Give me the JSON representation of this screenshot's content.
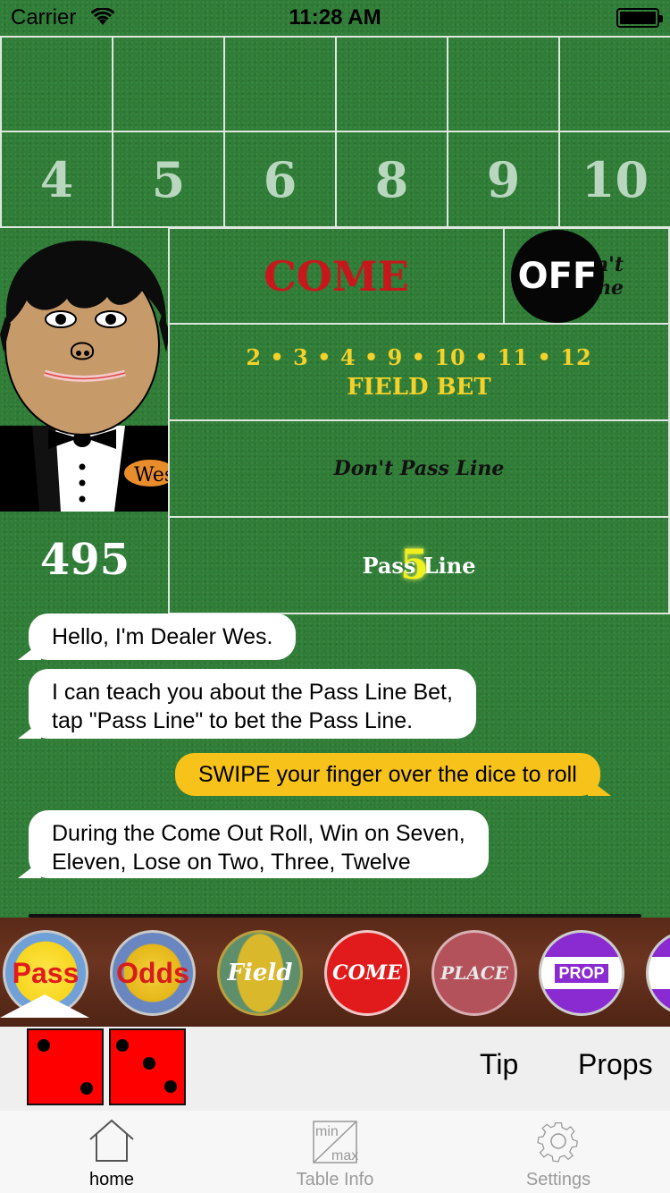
{
  "status_bar": {
    "carrier": "Carrier",
    "time": "11:28 AM"
  },
  "table": {
    "place_numbers": [
      "4",
      "5",
      "6",
      "8",
      "9",
      "10"
    ],
    "come_label": "COME",
    "dont_come_label_line1": "Don't",
    "dont_come_label_line2": "Come",
    "puck_label": "OFF",
    "field_numbers": "2 • 3 • 4 • 9 • 10 • 11 • 12",
    "field_label": "FIELD BET",
    "dont_pass_label": "Don't Pass Line",
    "pass_label": "Pass Line",
    "point_marker": "5"
  },
  "dealer": {
    "name_tag": "Wes",
    "bankroll": "495"
  },
  "chat": {
    "messages": [
      {
        "text": "Hello, I'm Dealer Wes."
      },
      {
        "text_line1": "I can teach you about the Pass Line Bet,",
        "text_line2": "tap \"Pass Line\" to bet the Pass Line."
      },
      {
        "text": "SWIPE your finger over the dice to roll"
      },
      {
        "text_line1": "During the Come Out Roll, Win on Seven,",
        "text_line2": "Eleven, Lose on Two, Three, Twelve"
      }
    ]
  },
  "chip_rail": {
    "chips": [
      {
        "label": "Pass",
        "color": "#f7d51f"
      },
      {
        "label": "Odds",
        "color": "#e6b619"
      },
      {
        "label": "Field",
        "color": "#6b9a6b"
      },
      {
        "label": "COME",
        "color": "#e11b1b"
      },
      {
        "label": "PLACE",
        "color": "#b3525b"
      },
      {
        "label": "PROP",
        "color": "#8a2bd2"
      },
      {
        "label": "P",
        "color": "#8a2bd2"
      }
    ],
    "selected": "Pass"
  },
  "controls": {
    "tip_label": "Tip",
    "props_label": "Props",
    "dice_values": [
      2,
      3
    ]
  },
  "tab_bar": {
    "tabs": [
      {
        "label": "home",
        "icon": "house-icon",
        "active": true
      },
      {
        "label": "Table Info",
        "icon": "min-max-icon",
        "icon_top": "min",
        "icon_bottom": "max",
        "active": false
      },
      {
        "label": "Settings",
        "icon": "gear-icon",
        "active": false
      }
    ]
  }
}
